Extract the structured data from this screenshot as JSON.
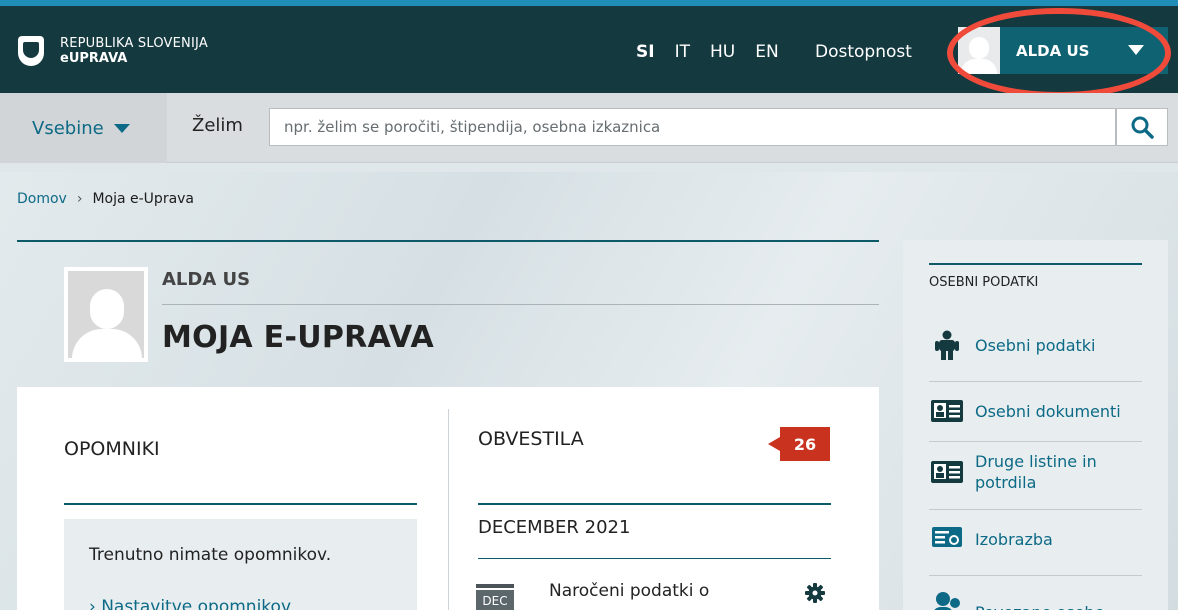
{
  "header": {
    "logo_line1": "REPUBLIKA SLOVENIJA",
    "logo_line2": "eUPRAVA",
    "languages": [
      "SI",
      "IT",
      "HU",
      "EN"
    ],
    "active_language": "SI",
    "accessibility": "Dostopnost",
    "username": "ALDA US"
  },
  "searchbar": {
    "menu_label": "Vsebine",
    "want_label": "Želim",
    "placeholder": "npr. želim se poročiti, štipendija, osebna izkaznica"
  },
  "breadcrumb": {
    "home": "Domov",
    "separator": "›",
    "current": "Moja e-Uprava"
  },
  "profile": {
    "name": "ALDA US",
    "title": "MOJA E-UPRAVA"
  },
  "reminders": {
    "heading": "OPOMNIKI",
    "empty_text": "Trenutno nimate opomnikov.",
    "settings_link": "› Nastavitve opomnikov"
  },
  "notices": {
    "heading": "OBVESTILA",
    "count": "26",
    "month": "DECEMBER 2021",
    "item_calendar": "DEC",
    "item_title": "Naročeni podatki o"
  },
  "sidebar": {
    "title": "OSEBNI PODATKI",
    "items": [
      {
        "label": "Osebni podatki",
        "icon": "person-icon"
      },
      {
        "label": "Osebni dokumenti",
        "icon": "id-card-icon"
      },
      {
        "label": "Druge listine in potrdila",
        "icon": "id-card-icon"
      },
      {
        "label": "Izobrazba",
        "icon": "certificate-icon"
      },
      {
        "label": "Povezane osebe",
        "icon": "people-icon"
      }
    ]
  },
  "colors": {
    "header_bg": "#143a40",
    "accent": "#0d6a86",
    "user_bg": "#0f6271",
    "badge": "#c8321f",
    "highlight": "#f04a3a"
  }
}
